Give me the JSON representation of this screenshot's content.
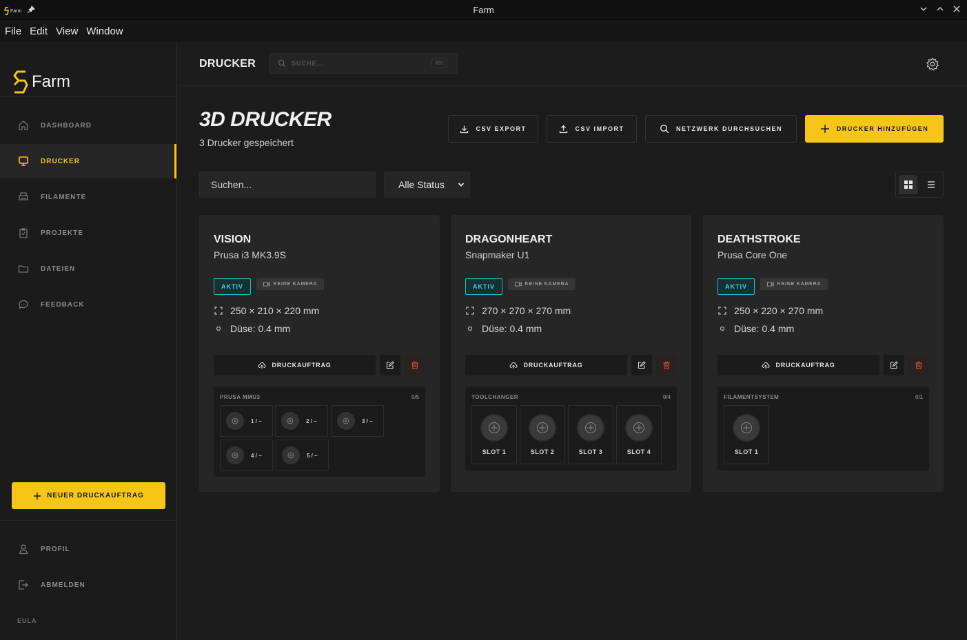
{
  "window": {
    "title": "Farm",
    "app_icon_text": "Farm"
  },
  "menubar": {
    "items": [
      "File",
      "Edit",
      "View",
      "Window"
    ]
  },
  "sidebar": {
    "logo": "Farm",
    "items": [
      {
        "label": "DASHBOARD",
        "icon": "home-icon",
        "active": false
      },
      {
        "label": "DRUCKER",
        "icon": "monitor-icon",
        "active": true
      },
      {
        "label": "FILAMENTE",
        "icon": "printer-icon",
        "active": false
      },
      {
        "label": "PROJEKTE",
        "icon": "clipboard-icon",
        "active": false
      },
      {
        "label": "DATEIEN",
        "icon": "folder-icon",
        "active": false
      },
      {
        "label": "FEEDBACK",
        "icon": "chat-icon",
        "active": false
      }
    ],
    "new_job_label": "NEUER DRUCKAUFTRAG",
    "profile_label": "PROFIL",
    "logout_label": "ABMELDEN",
    "eula_label": "EULA"
  },
  "topbar": {
    "section_title": "DRUCKER",
    "search_placeholder": "SUCHE...",
    "shortcut": "⌘K"
  },
  "page": {
    "title": "3D DRUCKER",
    "subtitle": "3 Drucker gespeichert",
    "actions": {
      "csv_export": "CSV EXPORT",
      "csv_import": "CSV IMPORT",
      "scan": "NETZWERK DURCHSUCHEN",
      "add": "DRUCKER HINZUFÜGEN"
    },
    "filter": {
      "search_placeholder": "Suchen...",
      "status_selected": "Alle Status"
    }
  },
  "colors": {
    "accent": "#f5c518",
    "active_badge": "#3fd0e0",
    "danger": "#e0543a"
  },
  "printers": [
    {
      "name": "VISION",
      "model": "Prusa i3 MK3.9S",
      "status": "AKTIV",
      "camera": "KEINE KAMERA",
      "build_volume": "250 × 210 × 220 mm",
      "nozzle": "Düse: 0.4 mm",
      "job_label": "DRUCKAUFTRAG",
      "system": {
        "name": "PRUSA MMU3",
        "count": "0/5",
        "slots": [
          "1 / –",
          "2 / –",
          "3 / –",
          "4 / –",
          "5 / –"
        ]
      }
    },
    {
      "name": "DRAGONHEART",
      "model": "Snapmaker U1",
      "status": "AKTIV",
      "camera": "KEINE KAMERA",
      "build_volume": "270 × 270 × 270 mm",
      "nozzle": "Düse: 0.4 mm",
      "job_label": "DRUCKAUFTRAG",
      "system": {
        "name": "TOOLCHANGER",
        "count": "0/4",
        "slots": [
          "SLOT 1",
          "SLOT 2",
          "SLOT 3",
          "SLOT 4"
        ]
      }
    },
    {
      "name": "DEATHSTROKE",
      "model": "Prusa Core One",
      "status": "AKTIV",
      "camera": "KEINE KAMERA",
      "build_volume": "250 × 220 × 270 mm",
      "nozzle": "Düse: 0.4 mm",
      "job_label": "DRUCKAUFTRAG",
      "system": {
        "name": "FILAMENTSYSTEM",
        "count": "0/1",
        "slots": [
          "SLOT 1"
        ]
      }
    }
  ]
}
